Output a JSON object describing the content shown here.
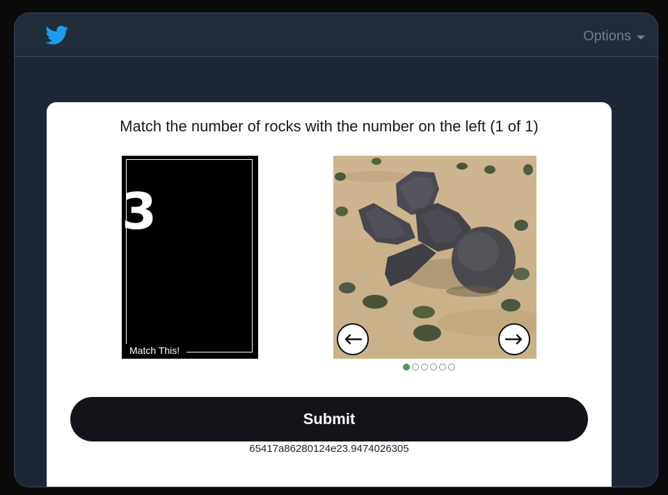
{
  "header": {
    "logo_icon": "twitter-bird-icon",
    "options_label": "Options",
    "options_icon": "caret-down-icon"
  },
  "colors": {
    "window_bg": "#1d2634",
    "header_bg": "#212c3b",
    "brand_blue": "#1d9bf0",
    "submit_bg": "#121419",
    "active_dot": "#4b9a57"
  },
  "challenge": {
    "instruction": "Match the number of rocks with the number on the left (1 of 1)",
    "reference_number": "3",
    "reference_caption": "Match This!",
    "prev_icon": "arrow-left-icon",
    "next_icon": "arrow-right-icon",
    "image_count": 6,
    "current_image": 1,
    "submit_label": "Submit",
    "session_id": "65417a86280124e23.9474026305"
  }
}
